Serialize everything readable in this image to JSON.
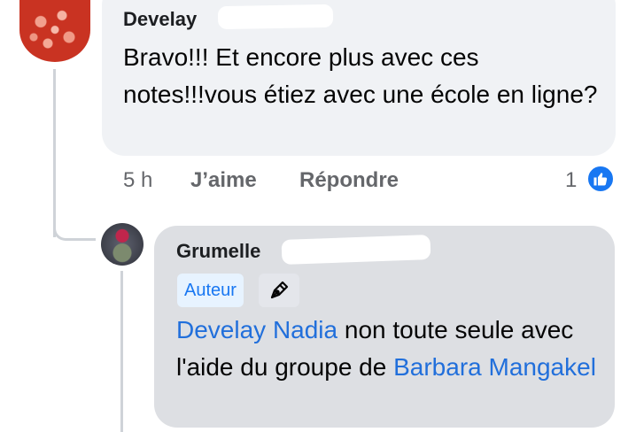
{
  "comment1": {
    "author": "Develay",
    "text": "Bravo!!! Et encore plus avec ces notes!!!vous étiez avec une école en ligne?",
    "time": "5 h",
    "like_label": "J’aime",
    "reply_label": "Répondre",
    "reaction_count": "1",
    "reaction_icon": "thumbs-up-icon"
  },
  "reply1": {
    "author": "Grumelle",
    "badge_label": "Auteur",
    "badge_icon": "pen-nib-icon",
    "mention1": "Develay Nadia",
    "text_middle": " non toute seule avec l'aide du groupe de ",
    "mention2": "Barbara Mangakel"
  },
  "colors": {
    "link_blue": "#216fdb",
    "facebook_blue": "#1877f2",
    "bubble_gray": "#f0f2f5",
    "reply_bubble_gray": "#dddfe3"
  }
}
